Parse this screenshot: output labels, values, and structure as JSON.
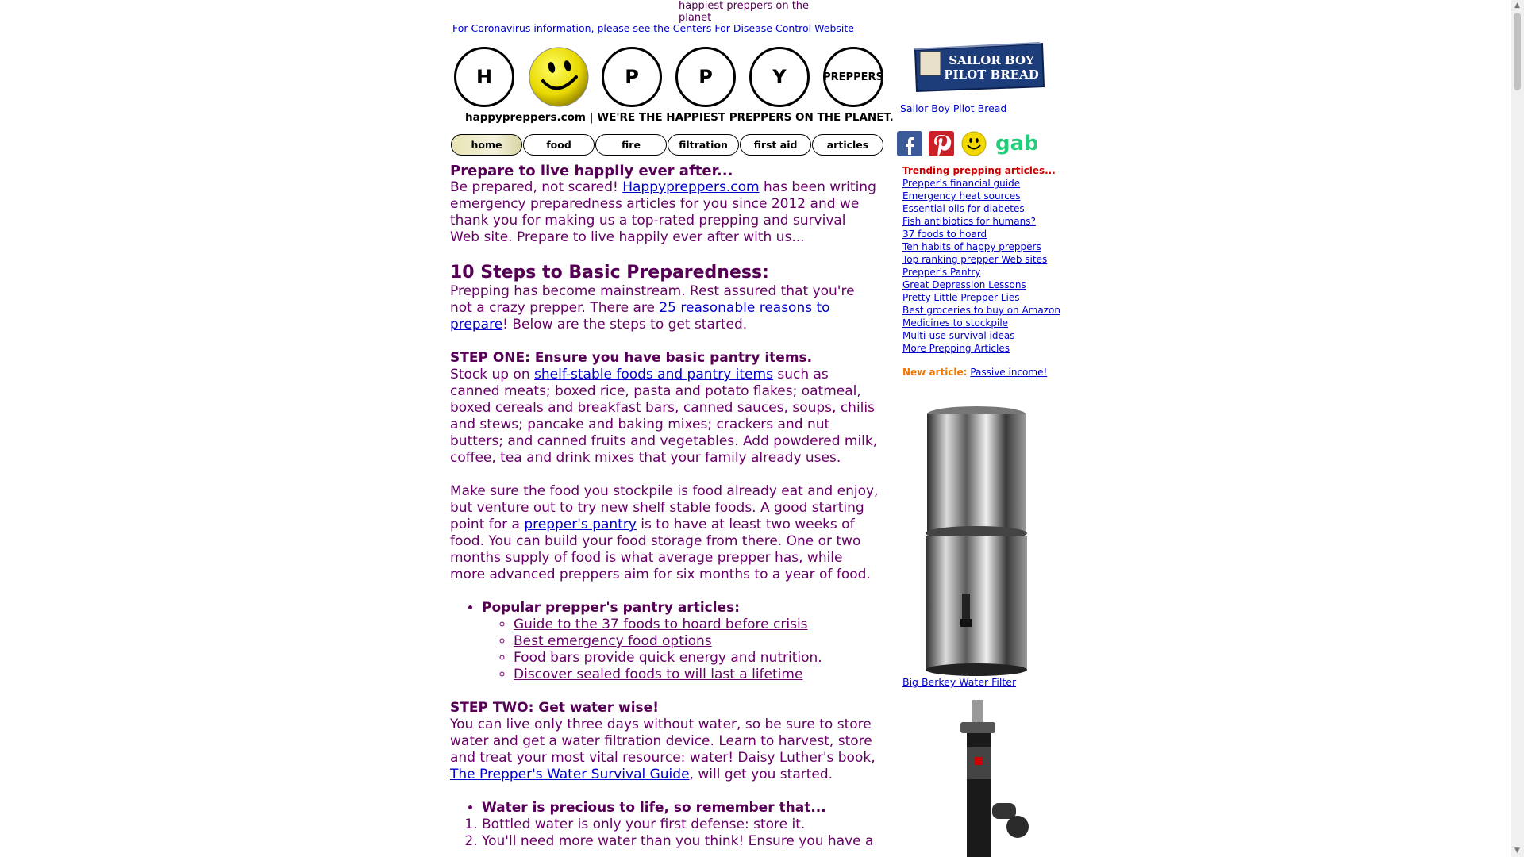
{
  "header": {
    "tagline": "happiest preppers on the planet",
    "corona_link": "For Coronavirus information, please see the Centers For Disease Control Website",
    "logo_letters": [
      "H",
      "P",
      "P",
      "Y",
      "PREPPERS"
    ],
    "motto": "happypreppers.com | WE'RE THE HAPPIEST PREPPERS ON THE PLANET."
  },
  "nav": [
    "home",
    "food",
    "fire",
    "filtration",
    "first aid",
    "articles"
  ],
  "main": {
    "intro_heading": "Prepare to live happily ever after...",
    "intro_a": "Be prepared, not scared! ",
    "intro_link": "Happypreppers.com",
    "intro_b": " has been writing emergency preparedness articles for you since 2012 and we thank you for making us a top-rated prepping and survival Web site. Prepare to live happily ever after with us...",
    "steps_heading": "10 Steps to Basic Preparedness:",
    "steps_a": "Prepping has become mainstream. Rest assured that you're not a crazy prepper. There are ",
    "steps_link": "25 reasonable reasons to prepare",
    "steps_b": "! Below are the steps to get started.",
    "step1_heading": "STEP ONE: Ensure you have basic pantry items.",
    "step1_a": "Stock up on ",
    "step1_link": "shelf-stable foods and pantry items",
    "step1_b": " such as canned meats; boxed rice, pasta and potato flakes; oatmeal, boxed cereals and breakfast bars, canned sauces, soups, chilis and stews; pancake and baking mixes; crackers and nut butters; and canned fruits and vegetables. Add powdered milk, coffee, tea and drink mixes that your family already uses.",
    "step1_p2_a": "Make sure the food you stockpile is food already eat and enjoy, but venture out to try new shelf stable foods. A good starting point for a ",
    "step1_p2_link": "prepper's pantry",
    "step1_p2_b": " is to have at least two weeks of food. You can build your food storage from there. One or two months supply of food is what average prepper has, while more advanced preppers aim for six months to a year of food.",
    "pantry_list_heading": "Popular prepper's pantry articles:",
    "pantry_links": [
      "Guide to the 37 foods to hoard before crisis",
      "Best emergency food options",
      "Food bars provide quick energy and nutrition",
      "Discover sealed foods to will last a lifetime"
    ],
    "pantry_period": ".",
    "step2_heading": "STEP TWO: Get water wise!",
    "step2_a": "You can live only three days without water, so be sure to store water and get a water filtration device. Learn to harvest, store and treat your most vital resource: water! Daisy Luther's book, ",
    "step2_link": "The Prepper's Water Survival Guide",
    "step2_b": ", will get you started.",
    "water_heading": "Water is precious to life, so remember that...",
    "water_items": [
      "Bottled water is only your first defense: store it.",
      "You'll need more water than you think! Ensure you have a"
    ]
  },
  "sidebar": {
    "ad_title_1": "SAILOR BOY",
    "ad_title_2": "PILOT BREAD",
    "ad_link": "Sailor Boy Pilot Bread",
    "social": [
      "facebook-icon",
      "pinterest-icon",
      "smiley-icon",
      "gab-icon"
    ],
    "gab_label": "gab",
    "trending_heading": "Trending prepping articles...",
    "trending": [
      "Prepper's financial guide",
      "Emergency heat sources",
      "Essential oils for diabetes",
      "Fish antibiotics for humans?",
      "37 foods to hoard",
      "Ten habits of happy preppers",
      "Top ranking prepper Web sites",
      "Prepper's Pantry",
      "Great Depression Lessons",
      "Pretty Little Prepper Lies",
      "Best groceries to buy on Amazon",
      "Medicines to stockpile",
      "Multi-use survival ideas",
      "More Prepping Articles"
    ],
    "new_article_label": "New article:",
    "new_article_link": "Passive income!",
    "berkey_link": "Big Berkey Water Filter"
  },
  "colors": {
    "text": "#660066",
    "heading": "#550055",
    "link": "#0000cc",
    "trending": "#cc0000",
    "new_article": "#ee7700"
  }
}
